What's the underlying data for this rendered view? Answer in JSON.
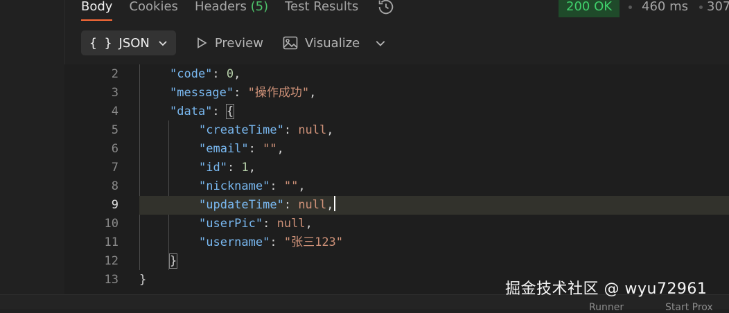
{
  "tabs": [
    {
      "label": "Body"
    },
    {
      "label": "Cookies"
    },
    {
      "label": "Headers",
      "count": "(5)"
    },
    {
      "label": "Test Results"
    }
  ],
  "status": {
    "code_text": "200 OK",
    "time": "460 ms",
    "size": "307"
  },
  "toolbar": {
    "format_label": "JSON",
    "braces": "{ }",
    "preview_label": "Preview",
    "visualize_label": "Visualize"
  },
  "editor": {
    "lines": [
      "2",
      "3",
      "4",
      "5",
      "6",
      "7",
      "8",
      "9",
      "10",
      "11",
      "12",
      "13"
    ],
    "current_line": "9",
    "keys": {
      "code": "\"code\"",
      "message": "\"message\"",
      "data": "\"data\"",
      "createTime": "\"createTime\"",
      "email": "\"email\"",
      "id": "\"id\"",
      "nickname": "\"nickname\"",
      "updateTime": "\"updateTime\"",
      "userPic": "\"userPic\"",
      "username": "\"username\""
    },
    "values": {
      "code": "0",
      "message": "\"操作成功\"",
      "createTime": "null",
      "email": "\"\"",
      "id": "1",
      "nickname": "\"\"",
      "updateTime": "null",
      "userPic": "null",
      "username": "\"张三123\""
    }
  },
  "bottom": {
    "left": "Runner",
    "right": "Start Prox"
  },
  "watermark": "掘金技术社区 @ wyu72961"
}
